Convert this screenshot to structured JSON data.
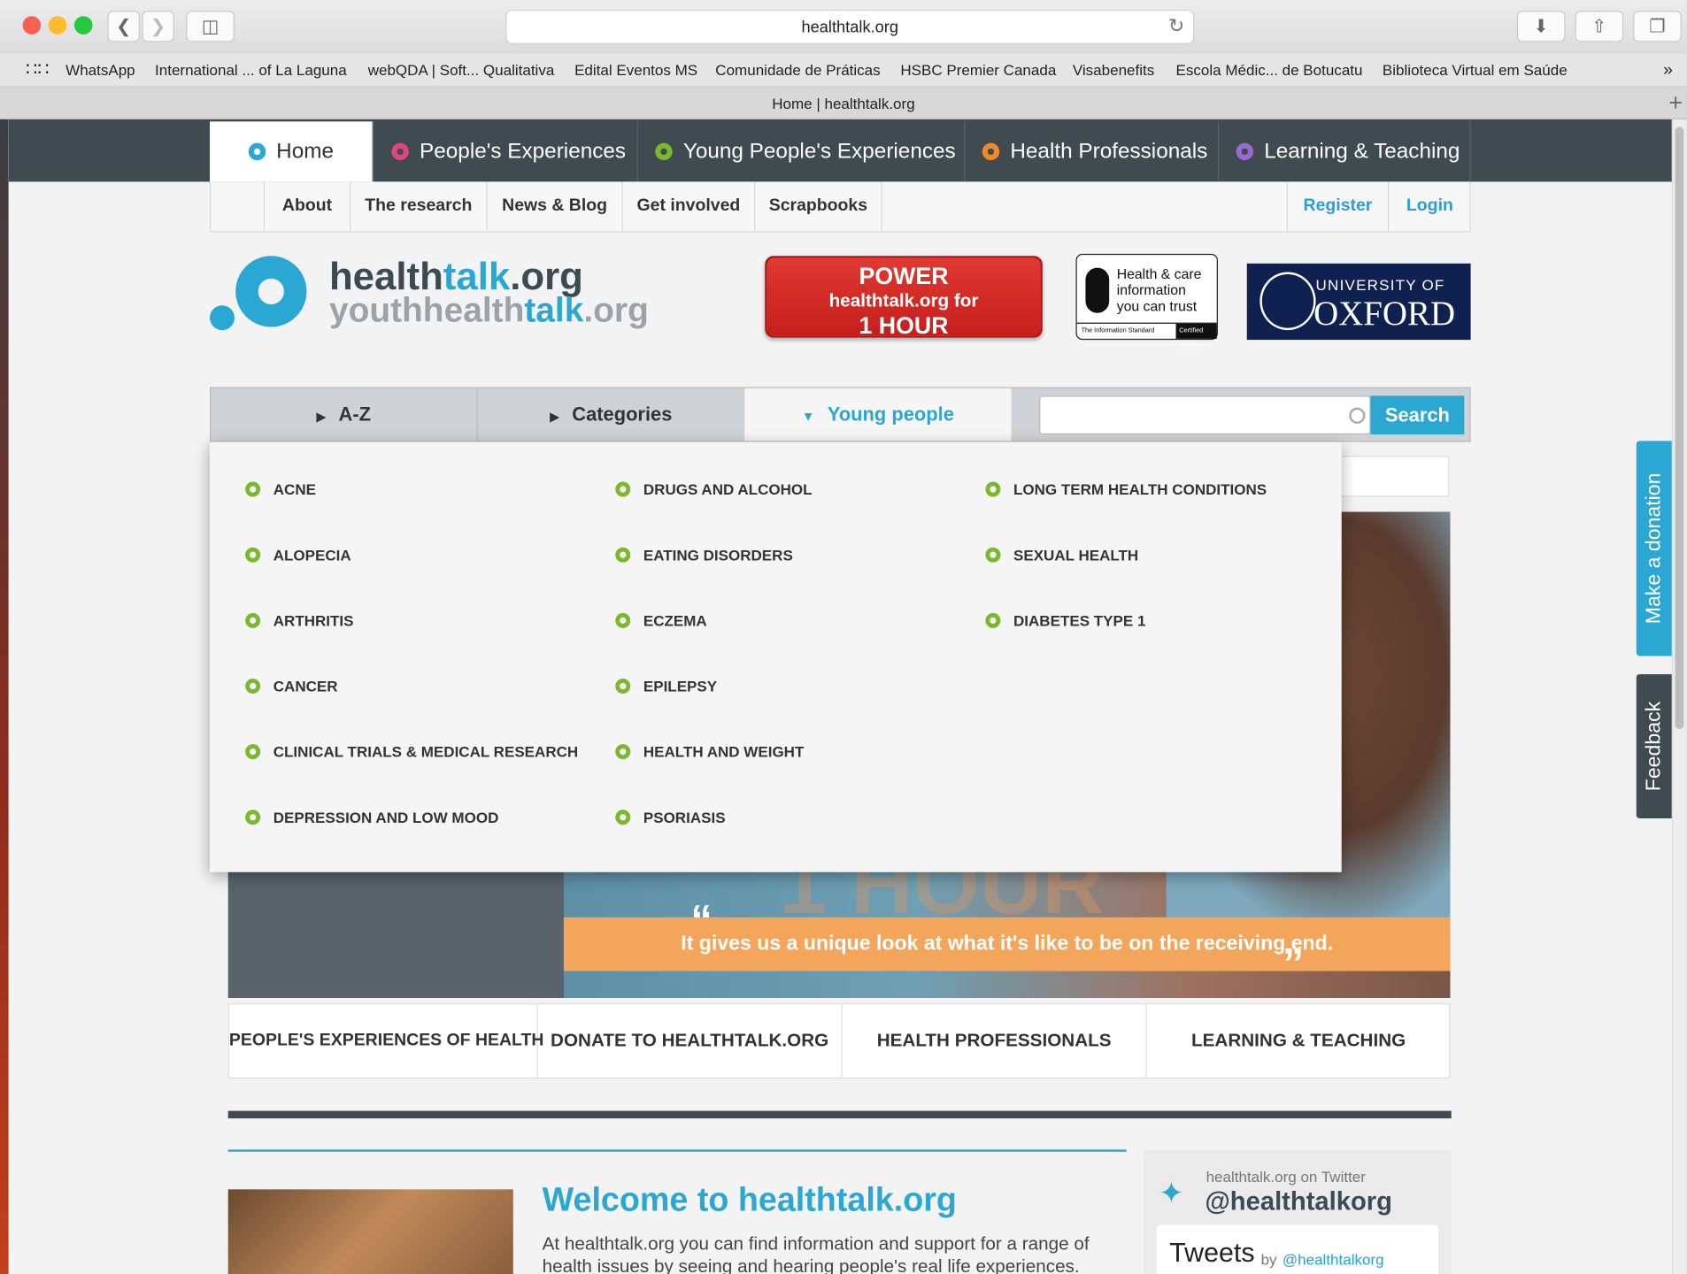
{
  "browser": {
    "url": "healthtalk.org",
    "tab_title": "Home | healthtalk.org"
  },
  "bookmarks": [
    "WhatsApp",
    "International ... of La Laguna",
    "webQDA | Soft... Qualitativa",
    "Edital Eventos MS",
    "Comunidade de Práticas",
    "HSBC Premier Canada",
    "Visabenefits",
    "Escola Médic... de Botucatu",
    "Biblioteca Virtual em Saúde"
  ],
  "main_nav": [
    {
      "label": "Home",
      "color": "#2aa7d2"
    },
    {
      "label": "People's Experiences",
      "color": "#e0457b"
    },
    {
      "label": "Young People's Experiences",
      "color": "#7ab929"
    },
    {
      "label": "Health Professionals",
      "color": "#f08a24"
    },
    {
      "label": "Learning & Teaching",
      "color": "#9b6ad0"
    }
  ],
  "sub_nav": [
    "About",
    "The research",
    "News & Blog",
    "Get involved",
    "Scrapbooks"
  ],
  "auth": {
    "register": "Register",
    "login": "Login"
  },
  "logo": {
    "line1_a": "health",
    "line1_b": "talk",
    "line1_c": ".org",
    "line2_a": "youthhealth",
    "line2_b": "talk",
    "line2_c": ".org"
  },
  "power": {
    "l1": "POWER",
    "l2": "healthtalk.org for",
    "l3": "1 HOUR"
  },
  "hcit": {
    "l1": "Health & care",
    "l2": "information",
    "l3": "you can trust",
    "foot1": "The Information Standard",
    "foot2": "Certified Member"
  },
  "oxford": {
    "l1": "UNIVERSITY OF",
    "l2": "OXFORD"
  },
  "search": {
    "tabs": [
      "A-Z",
      "Categories",
      "Young people"
    ],
    "button": "Search"
  },
  "dropdown": {
    "col1": [
      "ACNE",
      "ALOPECIA",
      "ARTHRITIS",
      "CANCER",
      "CLINICAL TRIALS & MEDICAL RESEARCH",
      "DEPRESSION AND LOW MOOD"
    ],
    "col2": [
      "DRUGS AND ALCOHOL",
      "EATING DISORDERS",
      "ECZEMA",
      "EPILEPSY",
      "HEALTH AND WEIGHT",
      "PSORIASIS"
    ],
    "col3": [
      "LONG TERM HEALTH CONDITIONS",
      "SEXUAL HEALTH",
      "DIABETES TYPE 1"
    ]
  },
  "hero": {
    "quote": "It gives us a unique look at what it's like to be on the receiving end.",
    "bg_word": "1 HOUR"
  },
  "tiles": [
    "PEOPLE'S EXPERIENCES OF HEALTH",
    "DONATE TO HEALTHTALK.ORG",
    "HEALTH PROFESSIONALS",
    "LEARNING & TEACHING"
  ],
  "welcome": {
    "title": "Welcome to healthtalk.org",
    "text": "At healthtalk.org you can find information and support for a range of health issues by seeing and hearing people's real life experiences."
  },
  "twitter": {
    "on": "healthtalk.org on Twitter",
    "handle": "@healthtalkorg",
    "tweets": "Tweets",
    "by": "by",
    "by_handle": "@healthtalkorg"
  },
  "side_tabs": {
    "donate": "Make a donation",
    "feedback": "Feedback"
  }
}
